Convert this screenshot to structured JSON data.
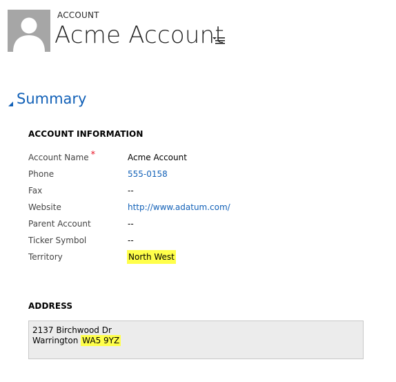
{
  "header": {
    "entity_label": "ACCOUNT",
    "record_title": "Acme Account",
    "avatar_icon": "person-silhouette-icon",
    "menu_icon": "record-menu-icon"
  },
  "section": {
    "title": "Summary",
    "toggle_icon": "collapse-triangle-icon"
  },
  "account_information": {
    "title": "ACCOUNT INFORMATION",
    "fields": [
      {
        "label": "Account Name",
        "required": "*",
        "value": "Acme Account"
      },
      {
        "label": "Phone",
        "value": "555-0158"
      },
      {
        "label": "Fax",
        "value": "--"
      },
      {
        "label": "Website",
        "value": "http://www.adatum.com/"
      },
      {
        "label": "Parent Account",
        "value": "--"
      },
      {
        "label": "Ticker Symbol",
        "value": "--"
      },
      {
        "label": "Territory",
        "value": "North West"
      }
    ]
  },
  "address": {
    "title": "ADDRESS",
    "line1": "2137 Birchwood Dr",
    "city": "Warrington",
    "postcode": "WA5 9YZ"
  },
  "colors": {
    "link": "#1160b7",
    "highlight": "#ffff4a",
    "required": "#e81123",
    "avatar_bg": "#a6a6a6"
  }
}
